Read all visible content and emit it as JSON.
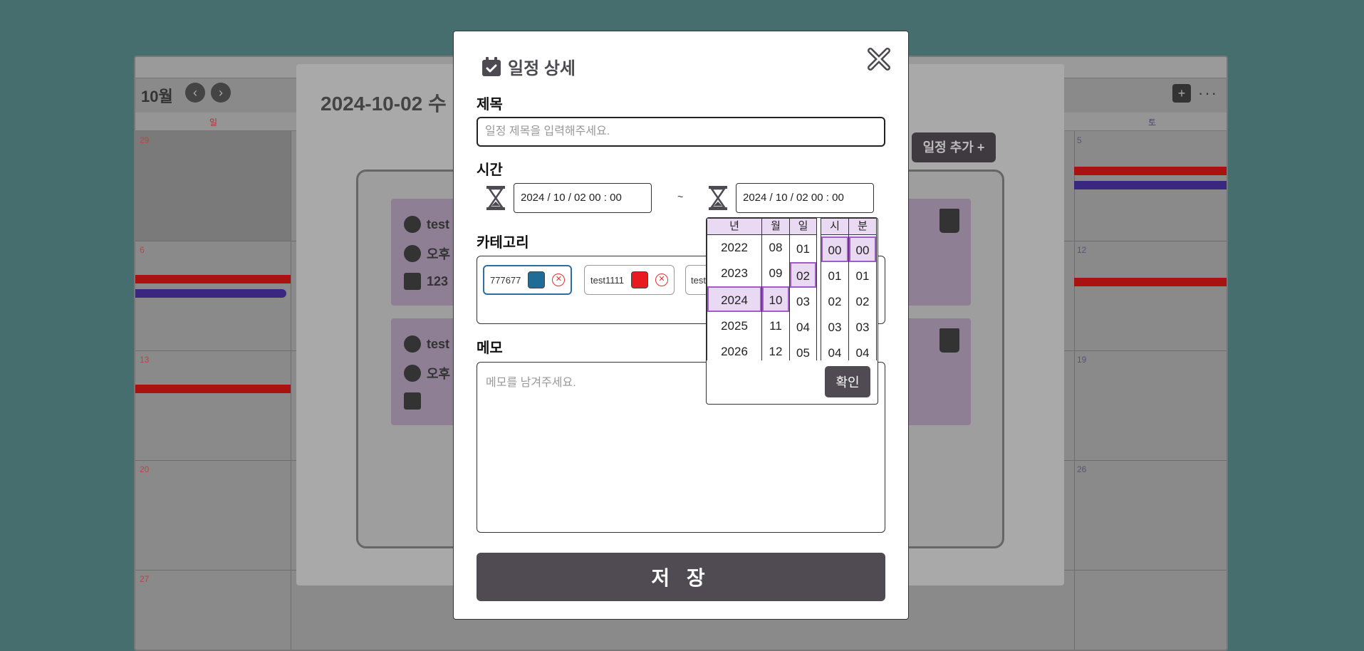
{
  "background": {
    "month": "10월",
    "day_title": "2024-10-02 수",
    "add_event_label": "일정 추가 +",
    "week_days": [
      "일",
      "토"
    ],
    "day_numbers": [
      "29",
      "5",
      "6",
      "12",
      "13",
      "19",
      "20",
      "26",
      "27"
    ],
    "cards": [
      {
        "title": "test",
        "time": "오후",
        "date": "123"
      },
      {
        "title": "test",
        "time": "오후",
        "date": ""
      }
    ]
  },
  "modal": {
    "title": "일정 상세",
    "title_label": "제목",
    "title_placeholder": "일정 제목을 입력해주세요.",
    "time_label": "시간",
    "start_time": "2024 / 10 / 02  00 : 00",
    "tilde": "~",
    "end_time": "2024 / 10 / 02  00 : 00",
    "category_label": "카테고리",
    "categories": [
      {
        "name": "777677",
        "color": "#1f6d96",
        "selected": true
      },
      {
        "name": "test1111",
        "color": "#e8191f",
        "selected": false
      },
      {
        "name": "test",
        "color": "#777777",
        "selected": false
      }
    ],
    "memo_label": "메모",
    "memo_placeholder": "메모를 남겨주세요.",
    "save_label": "저 장"
  },
  "picker": {
    "headers": {
      "year": "년",
      "month": "월",
      "day": "일",
      "hour": "시",
      "minute": "분"
    },
    "years": [
      "2022",
      "2023",
      "2024",
      "2025",
      "2026"
    ],
    "months": [
      "08",
      "09",
      "10",
      "11",
      "12"
    ],
    "days": [
      "01",
      "02",
      "03",
      "04",
      "05"
    ],
    "hours": [
      "00",
      "01",
      "02",
      "03",
      "04"
    ],
    "minutes": [
      "00",
      "01",
      "02",
      "03",
      "04"
    ],
    "selected": {
      "year": "2024",
      "month": "10",
      "day": "02",
      "hour": "00",
      "minute": "00"
    },
    "confirm_label": "확인"
  },
  "colors": {
    "accent_dark": "#504a52",
    "picker_highlight": "#ead9f3",
    "picker_border": "#a05cc9",
    "backdrop": "#466e6e"
  }
}
